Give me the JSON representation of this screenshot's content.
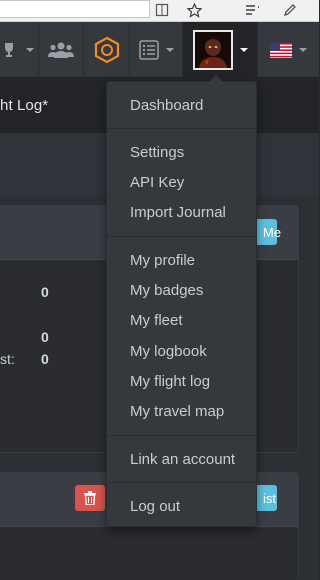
{
  "page": {
    "title_fragment": "ht Log*"
  },
  "dropdown": {
    "items": [
      {
        "label": "Dashboard"
      },
      {
        "label": "Settings"
      },
      {
        "label": "API Key"
      },
      {
        "label": "Import Journal"
      },
      {
        "label": "My profile"
      },
      {
        "label": "My badges"
      },
      {
        "label": "My fleet"
      },
      {
        "label": "My logbook"
      },
      {
        "label": "My flight log"
      },
      {
        "label": "My travel map"
      },
      {
        "label": "Link an account"
      },
      {
        "label": "Log out"
      }
    ]
  },
  "panel1": {
    "button_fragment": "Me",
    "stats": [
      {
        "value": "0"
      },
      {
        "value": "0"
      },
      {
        "value": "0",
        "label_fragment": "st:"
      }
    ]
  },
  "panel2": {
    "button_fragment": "ist"
  },
  "colors": {
    "navbar": "#35393e",
    "accent_hex": "#f28c28",
    "info": "#5bc0de",
    "danger": "#d9534f"
  },
  "icons": {
    "trophy": "trophy-icon",
    "group": "users-icon",
    "hexagon": "hexagon-icon",
    "list": "list-icon",
    "flag": "us-flag-icon",
    "trash": "trash-icon",
    "star": "star-icon",
    "reader": "reader-view-icon",
    "favorites": "favorites-list-icon",
    "pen": "pen-icon"
  }
}
